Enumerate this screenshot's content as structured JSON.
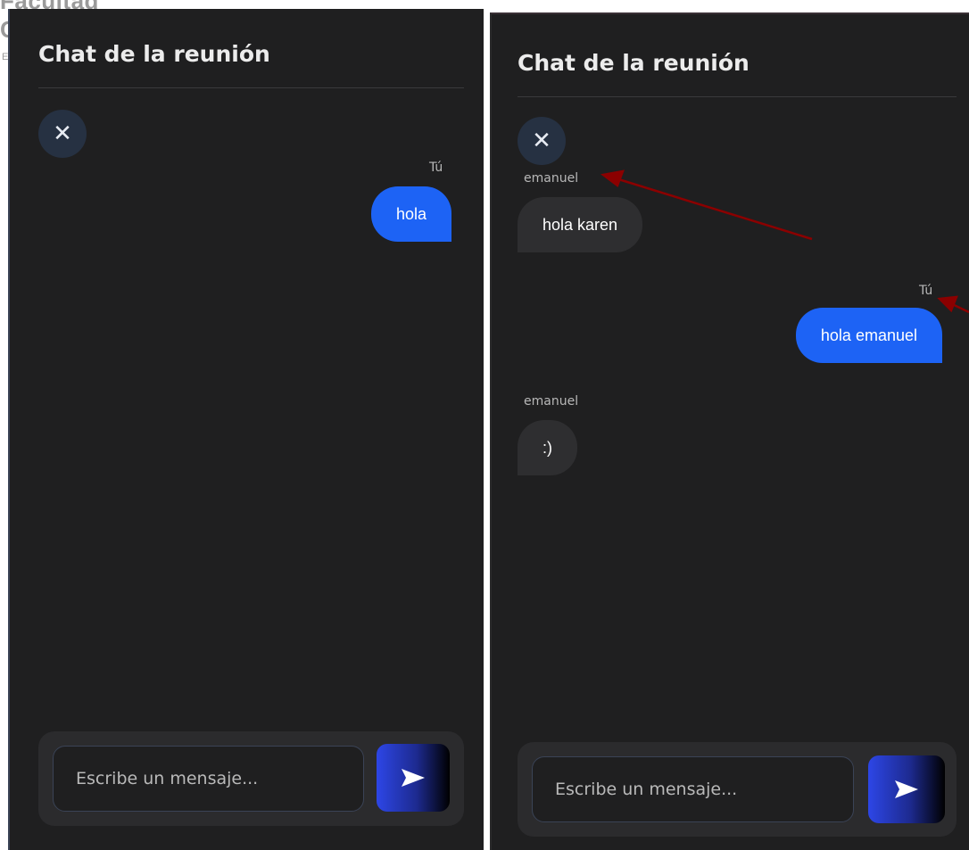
{
  "background": {
    "title": "Facultad",
    "letter": "C",
    "small": "E"
  },
  "panels": [
    {
      "title": "Chat de la reunión",
      "close_icon": "close-icon",
      "messages": [
        {
          "sender": "Tú",
          "text": "hola",
          "own": true
        }
      ],
      "input_placeholder": "Escribe un mensaje...",
      "send_icon": "send-icon"
    },
    {
      "title": "Chat de la reunión",
      "close_icon": "close-icon",
      "messages": [
        {
          "sender": "emanuel",
          "text": "hola karen",
          "own": false
        },
        {
          "sender": "Tú",
          "text": "hola emanuel",
          "own": true
        },
        {
          "sender": "emanuel",
          "text": ":)",
          "own": false
        }
      ],
      "input_placeholder": "Escribe un mensaje...",
      "send_icon": "send-icon"
    }
  ],
  "colors": {
    "panel_bg": "#1f1f20",
    "own_bubble": "#1d63f5",
    "other_bubble": "#2e2e30",
    "annotation_arrow": "#8b0000"
  }
}
